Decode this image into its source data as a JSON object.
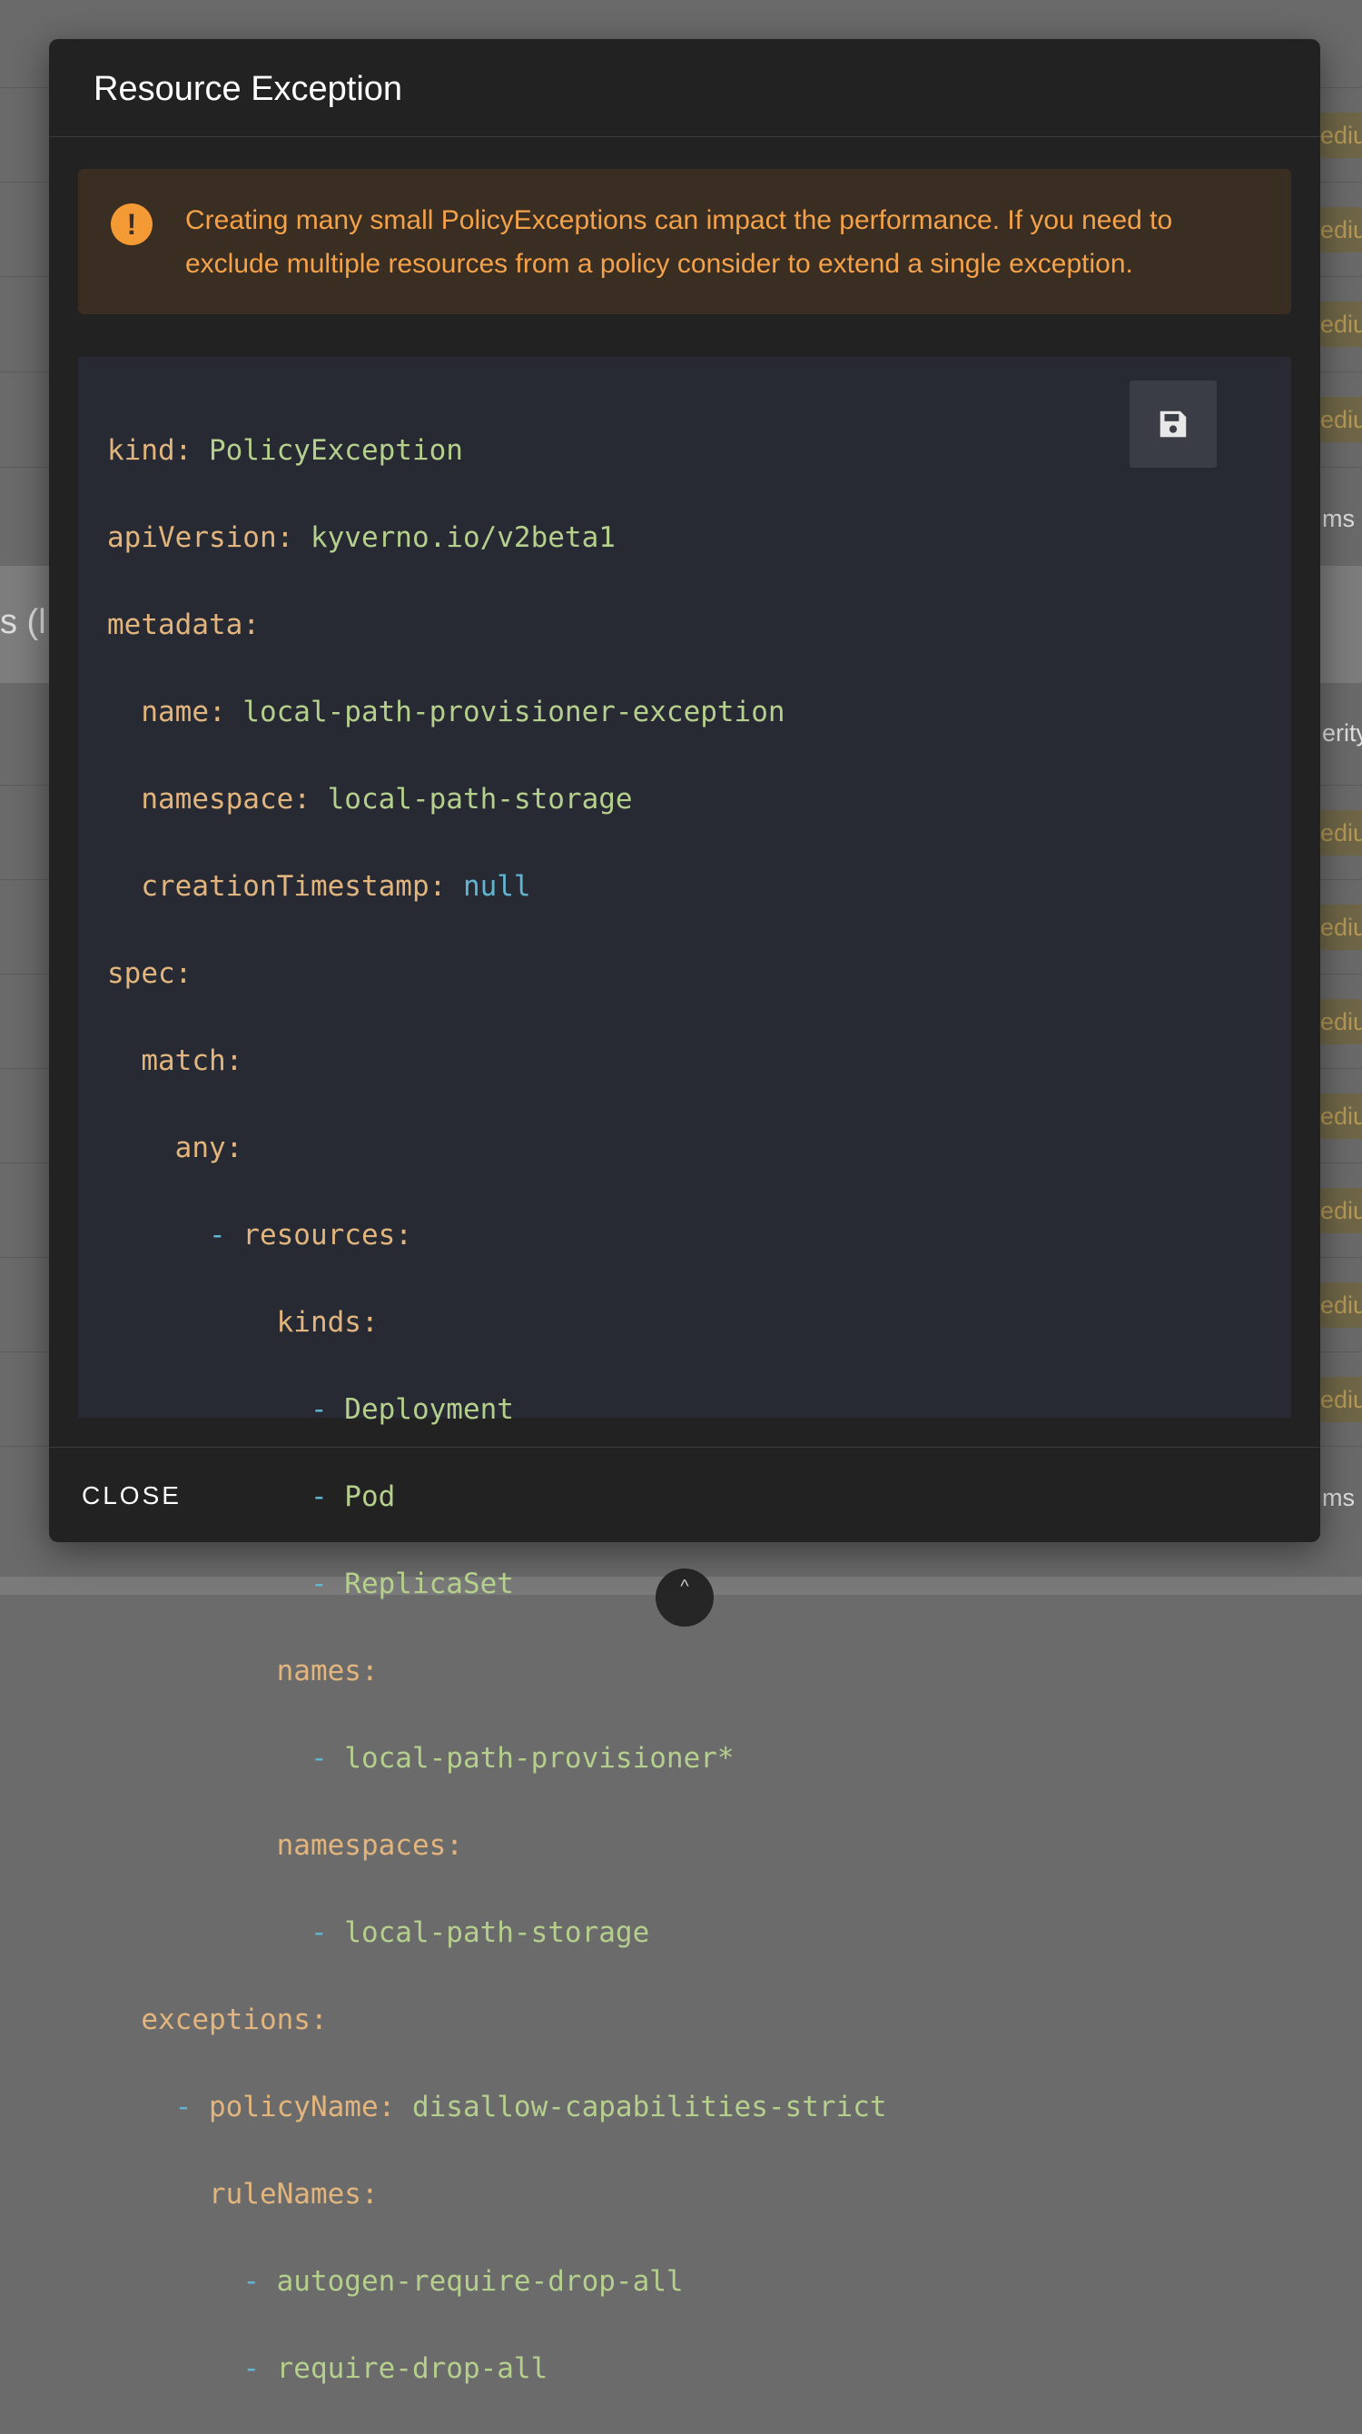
{
  "background": {
    "band_text": "s (l",
    "severity_chip_label": "ediur",
    "side_text_items": "ms",
    "side_text_severity": "erity"
  },
  "dialog": {
    "title": "Resource Exception",
    "alert": {
      "icon": "exclamation-icon",
      "message": "Creating many small PolicyExceptions can impact the performance. If you need to exclude multiple resources from a policy consider to extend a single exception."
    },
    "save_button": {
      "icon": "floppy-disk-icon"
    },
    "yaml": {
      "kind_key": "kind",
      "kind_value": "PolicyException",
      "api_key": "apiVersion",
      "api_value": "kyverno.io/v2beta1",
      "metadata_key": "metadata",
      "name_key": "name",
      "name_value": "local-path-provisioner-exception",
      "namespace_key": "namespace",
      "namespace_value": "local-path-storage",
      "creation_key": "creationTimestamp",
      "creation_value": "null",
      "spec_key": "spec",
      "match_key": "match",
      "any_key": "any",
      "resources_key": "resources",
      "kinds_key": "kinds",
      "kinds": [
        "Deployment",
        "Pod",
        "ReplicaSet"
      ],
      "names_key": "names",
      "names": [
        "local-path-provisioner*"
      ],
      "namespaces_key": "namespaces",
      "namespaces": [
        "local-path-storage"
      ],
      "exceptions_key": "exceptions",
      "policy_name_key": "policyName",
      "policy_name_value": "disallow-capabilities-strict",
      "rule_names_key": "ruleNames",
      "rule_names": [
        "autogen-require-drop-all",
        "require-drop-all"
      ]
    },
    "close_label": "CLOSE"
  },
  "colors": {
    "dialog_bg": "#222222",
    "alert_bg": "#3a2d22",
    "alert_text": "#f4a24a",
    "code_bg": "#272a33",
    "yaml_key": "#e2b57e",
    "yaml_value": "#b5cf8d",
    "yaml_null": "#63b4d0"
  }
}
